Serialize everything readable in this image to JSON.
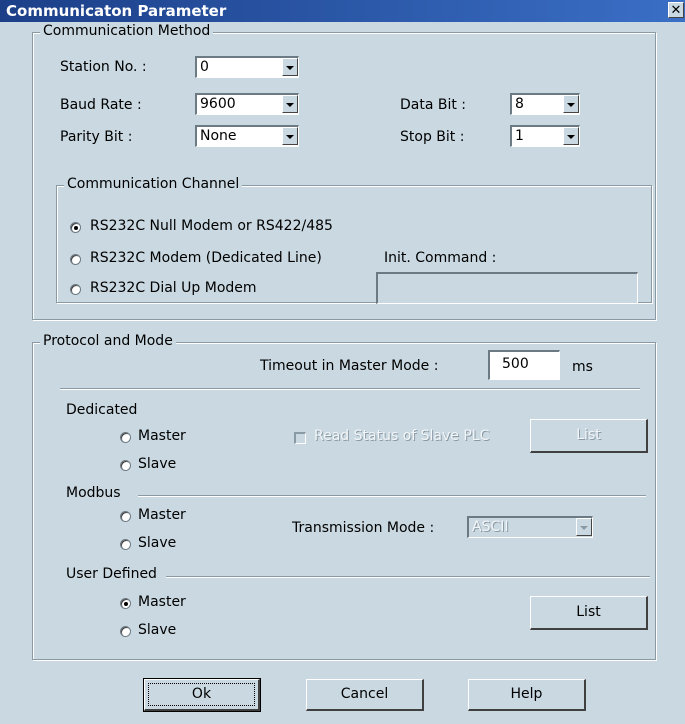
{
  "window": {
    "title": "Communicaton Parameter",
    "close_label": "✕"
  },
  "comm_method": {
    "legend": "Communication Method",
    "station_label": "Station No. :",
    "station_value": "0",
    "baud_label": "Baud Rate :",
    "baud_value": "9600",
    "parity_label": "Parity Bit :",
    "parity_value": "None",
    "databit_label": "Data Bit :",
    "databit_value": "8",
    "stopbit_label": "Stop Bit :",
    "stopbit_value": "1"
  },
  "channel": {
    "legend": "Communication Channel",
    "options": [
      {
        "label": "RS232C Null Modem or RS422/485",
        "selected": true
      },
      {
        "label": "RS232C Modem (Dedicated Line)",
        "selected": false
      },
      {
        "label": "RS232C Dial Up Modem",
        "selected": false
      }
    ],
    "init_label": "Init. Command :",
    "init_value": ""
  },
  "protocol": {
    "legend": "Protocol and Mode",
    "timeout_label": "Timeout in Master Mode :",
    "timeout_value": "500",
    "timeout_unit": "ms",
    "dedicated": {
      "label": "Dedicated",
      "master": "Master",
      "slave": "Slave",
      "read_status": "Read Status of Slave PLC",
      "list": "List"
    },
    "modbus": {
      "label": "Modbus",
      "master": "Master",
      "slave": "Slave",
      "transmission_label": "Transmission Mode :",
      "transmission_value": "ASCII"
    },
    "user_defined": {
      "label": "User Defined",
      "master": "Master",
      "slave": "Slave",
      "selected": "Master",
      "list": "List"
    }
  },
  "buttons": {
    "ok": "Ok",
    "cancel": "Cancel",
    "help": "Help"
  }
}
